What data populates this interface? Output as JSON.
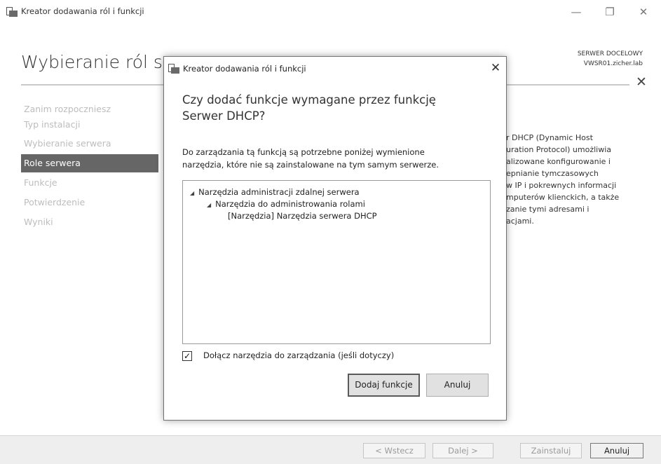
{
  "window": {
    "title": "Kreator dodawania ról i funkcji",
    "controls": {
      "minimize": "—",
      "restore": "❐",
      "close": "✕"
    }
  },
  "header": {
    "page_title": "Wybieranie ról serwera",
    "target_caption": "SERWER DOCELOWY",
    "target_name": "VWSR01.zicher.lab",
    "close_glyph": "✕"
  },
  "nav": {
    "items": [
      {
        "label": "Zanim rozpoczniesz",
        "active": false
      },
      {
        "label": "Typ instalacji",
        "active": false
      },
      {
        "label": "Wybieranie serwera",
        "active": false
      },
      {
        "label": "Role serwera",
        "active": true
      },
      {
        "label": "Funkcje",
        "active": false
      },
      {
        "label": "Potwierdzenie",
        "active": false
      },
      {
        "label": "Wyniki",
        "active": false
      }
    ]
  },
  "description": {
    "lines": [
      "r DHCP (Dynamic Host",
      "uration Protocol) umożliwia",
      "alizowane konfigurowanie i",
      "epnianie tymczasowych",
      "w IP i pokrewnych informacji",
      "mputerów klienckich, a także",
      "zanie tymi adresami i",
      "acjami."
    ]
  },
  "footer": {
    "back": "< Wstecz",
    "next": "Dalej >",
    "install": "Zainstaluj",
    "cancel": "Anuluj"
  },
  "dialog": {
    "title": "Kreator dodawania ról i funkcji",
    "close_glyph": "✕",
    "heading": "Czy dodać funkcje wymagane przez funkcję Serwer DHCP?",
    "intro_lines": [
      "Do zarządzania tą funkcją są potrzebne poniżej wymienione",
      "narzędzia, które nie są zainstalowane na tym samym serwerze."
    ],
    "tree": [
      {
        "label": "Narzędzia administracji zdalnej serwera",
        "expander": "◢"
      },
      {
        "label": "Narzędzia do administrowania rolami",
        "expander": "◢"
      },
      {
        "label": "[Narzędzia] Narzędzia serwera DHCP",
        "expander": ""
      }
    ],
    "checkbox": {
      "label": "Dołącz narzędzia do zarządzania (jeśli dotyczy)",
      "checked": true,
      "mark": "✓"
    },
    "add_button": "Dodaj funkcje",
    "cancel_button": "Anuluj"
  }
}
